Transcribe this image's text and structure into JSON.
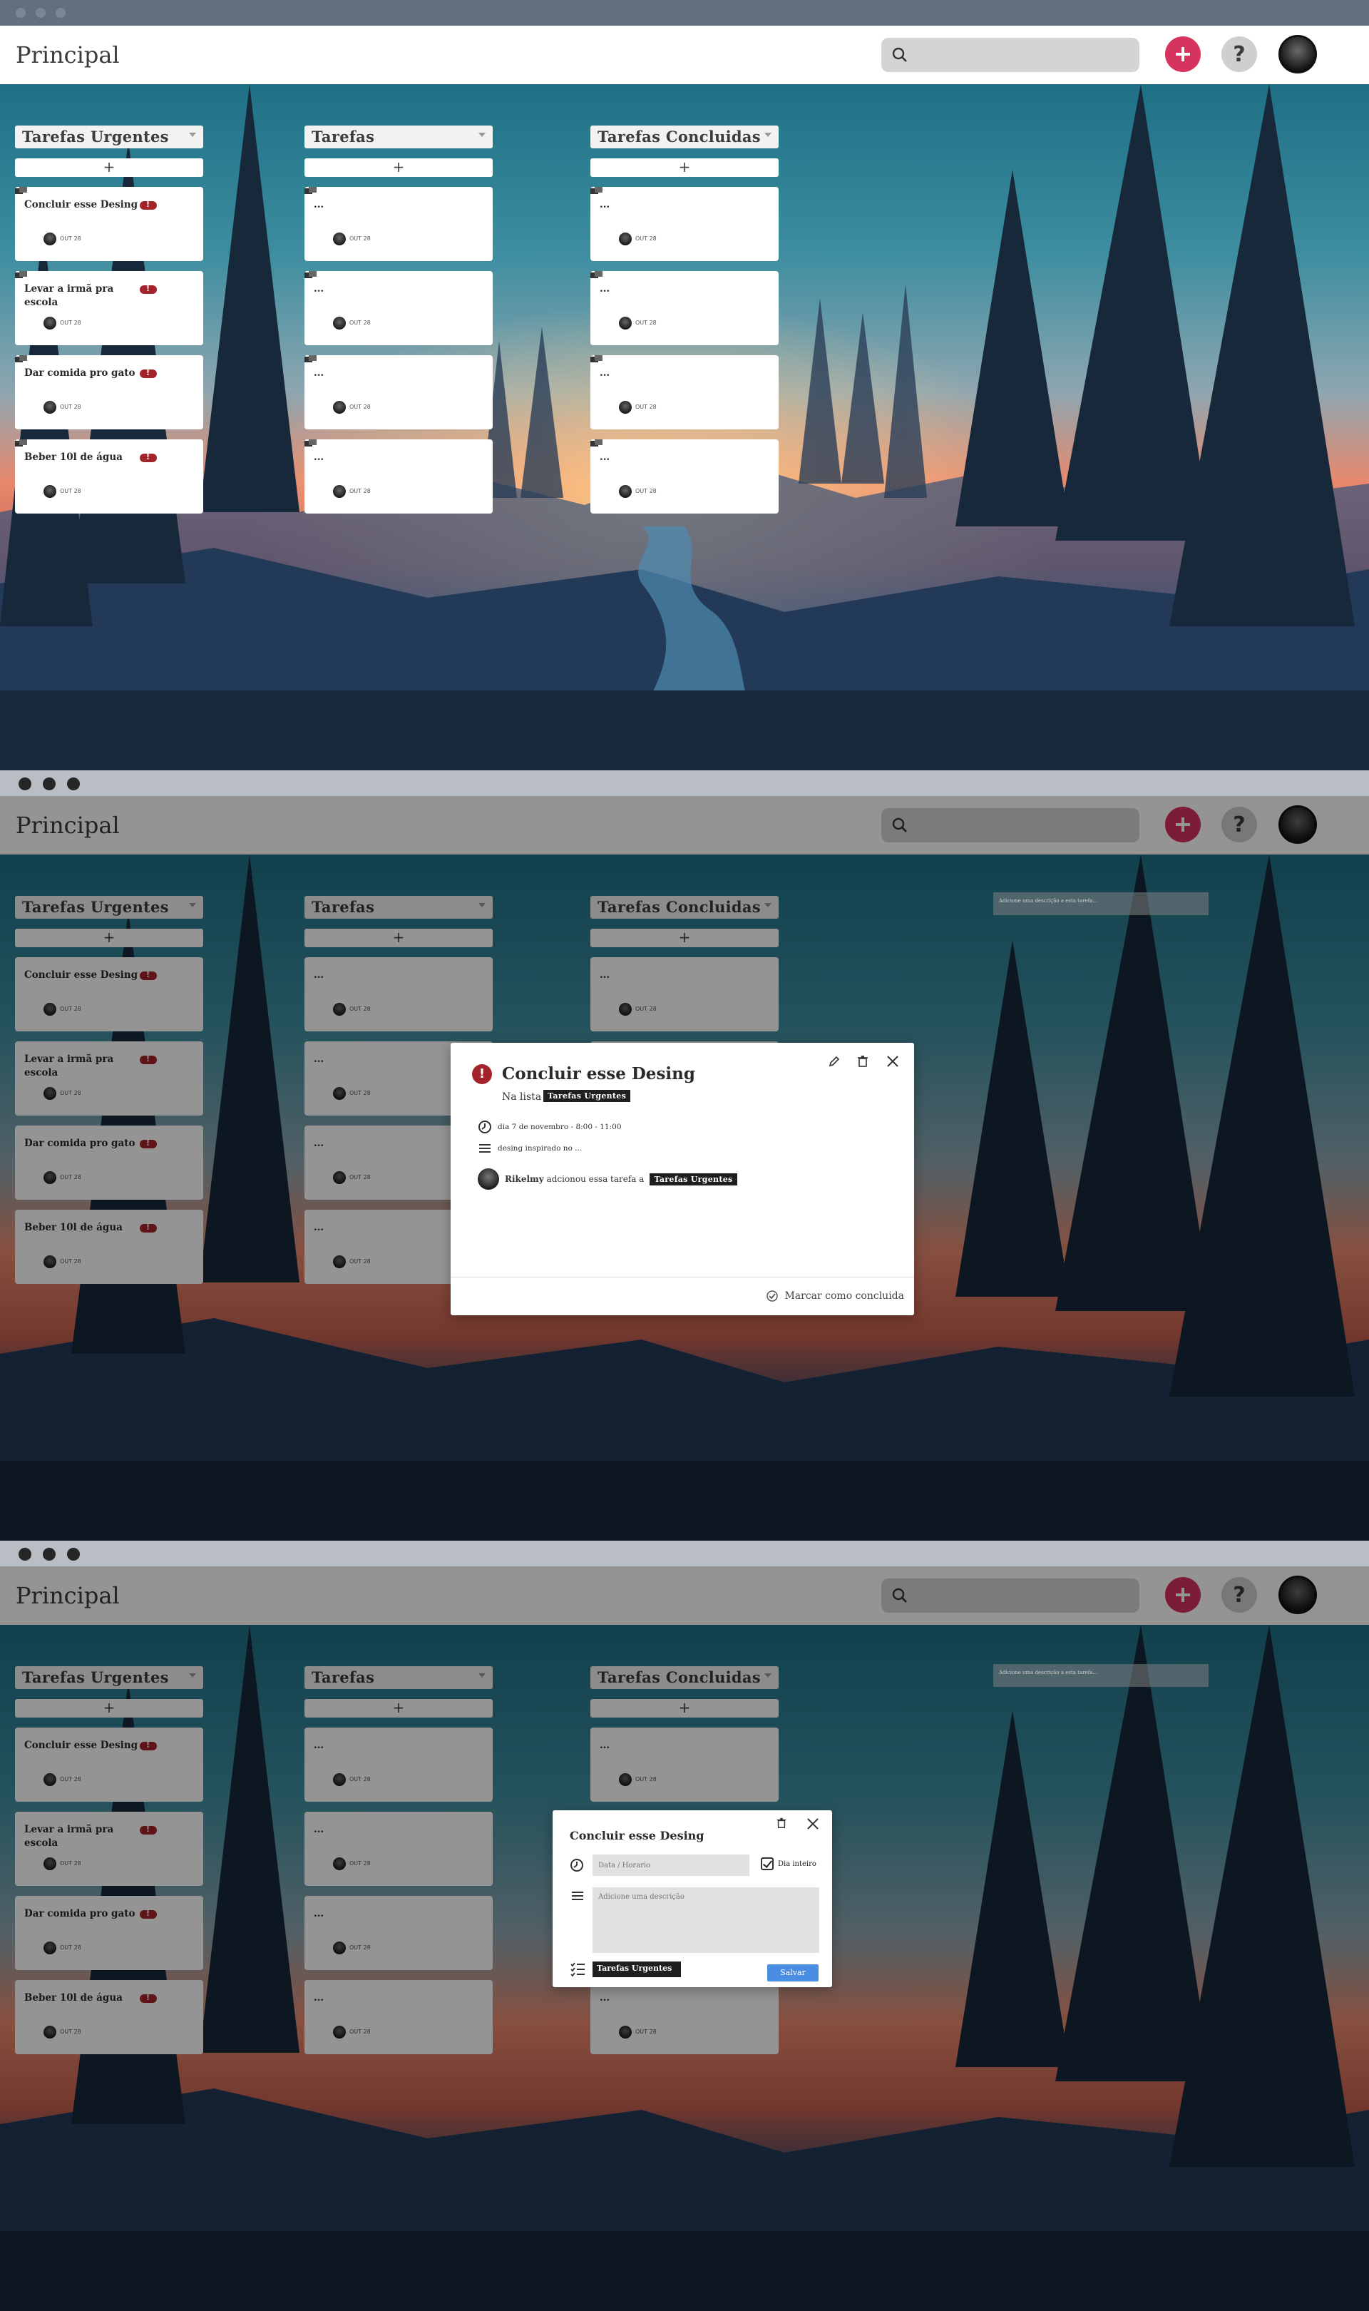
{
  "app": {
    "title": "Principal"
  },
  "search": {
    "placeholder": ""
  },
  "colors": {
    "accent": "#d6335f",
    "urgent": "#a3232a",
    "save": "#4a8ee4"
  },
  "icons": {
    "search": "search-icon",
    "add": "plus-icon",
    "help": "question-icon",
    "avatar": "user-avatar"
  },
  "columns": [
    {
      "title": "Tarefas  Urgentes",
      "add_label": "+",
      "cards": [
        {
          "title": "Concluir esse Desing",
          "date": "OUT 28",
          "urgent": true
        },
        {
          "title": "Levar a irmã pra escola",
          "date": "OUT 28",
          "urgent": true
        },
        {
          "title": "Dar comida pro gato",
          "date": "OUT 28",
          "urgent": true
        },
        {
          "title": "Beber 10l de água",
          "date": "OUT 28",
          "urgent": true
        }
      ]
    },
    {
      "title": "Tarefas",
      "add_label": "+",
      "cards": [
        {
          "title": "...",
          "date": "OUT 28",
          "urgent": false
        },
        {
          "title": "...",
          "date": "OUT 28",
          "urgent": false
        },
        {
          "title": "...",
          "date": "OUT 28",
          "urgent": false
        },
        {
          "title": "...",
          "date": "OUT 28",
          "urgent": false
        }
      ]
    },
    {
      "title": "Tarefas  Concluidas",
      "add_label": "+",
      "cards": [
        {
          "title": "...",
          "date": "OUT 28",
          "urgent": false
        },
        {
          "title": "...",
          "date": "OUT 28",
          "urgent": false
        },
        {
          "title": "...",
          "date": "OUT 28",
          "urgent": false
        },
        {
          "title": "...",
          "date": "OUT 28",
          "urgent": false
        }
      ]
    }
  ],
  "ghost_text": "Adicione uma descrição a esta tarefa...",
  "detail": {
    "alert": "!",
    "title": "Concluir esse Desing",
    "list_label": "Na lista",
    "list_name": "Tarefas  Urgentes",
    "date": "dia 7 de novembro - 8:00 - 11:00",
    "description": "desing inspirado no ...",
    "activity_user": "Rikelmy",
    "activity_text": "adcionou essa tarefa a",
    "activity_list": "Tarefas  Urgentes",
    "mark_done": "Marcar como concluida"
  },
  "edit": {
    "title": "Concluir esse Desing",
    "date_placeholder": "Data / Horario",
    "all_day": "Dia inteiro",
    "description_placeholder": "Adicione uma descrição",
    "list_name": "Tarefas  Urgentes",
    "save": "Salvar"
  }
}
